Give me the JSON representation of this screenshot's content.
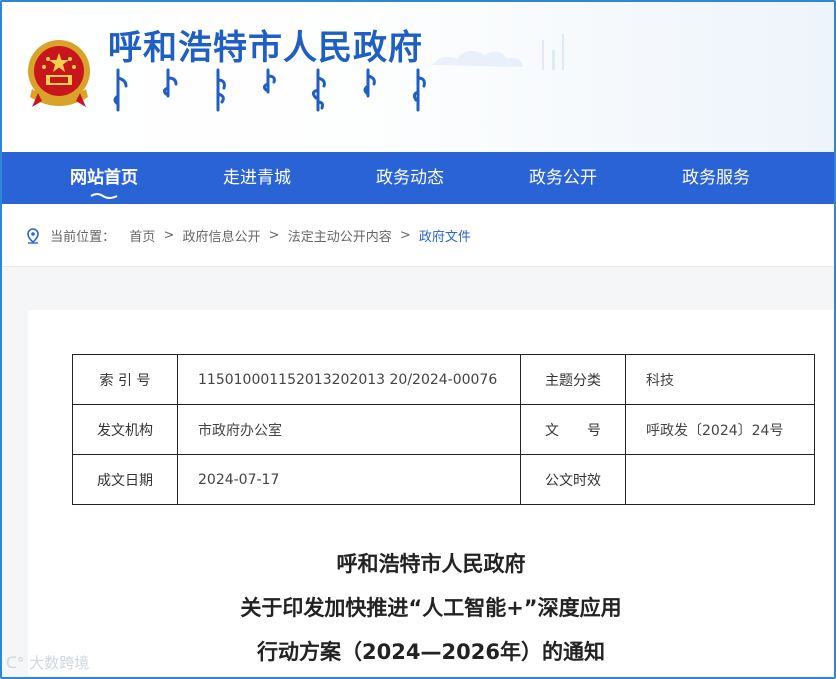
{
  "site": {
    "title": "呼和浩特市人民政府"
  },
  "nav": {
    "items": [
      {
        "label": "网站首页",
        "active": true
      },
      {
        "label": "走进青城"
      },
      {
        "label": "政务动态"
      },
      {
        "label": "政务公开"
      },
      {
        "label": "政务服务"
      }
    ]
  },
  "breadcrumb": {
    "prefix": "当前位置：",
    "items": [
      "首页",
      "政府信息公开",
      "法定主动公开内容",
      "政府文件"
    ],
    "separator": ">"
  },
  "meta_table": {
    "rows": [
      {
        "label1": "索 引 号",
        "value1": "115010001152013202013 20/2024-00076",
        "label2": "主题分类",
        "value2": "科技"
      },
      {
        "label1": "发文机构",
        "value1": "市政府办公室",
        "label2": "文　　号",
        "value2": "呼政发〔2024〕24号"
      },
      {
        "label1": "成文日期",
        "value1": "2024-07-17",
        "label2": "公文时效",
        "value2": ""
      }
    ]
  },
  "document": {
    "title_line1": "呼和浩特市人民政府",
    "title_line2": "关于印发加快推进“人工智能+”深度应用",
    "title_line3": "行动方案（2024—2026年）的通知"
  },
  "watermark": {
    "text": "大数跨境"
  },
  "colors": {
    "nav_bg": "#2a63d6",
    "title_blue": "#1f5fc4",
    "accent": "#2a63d6"
  }
}
